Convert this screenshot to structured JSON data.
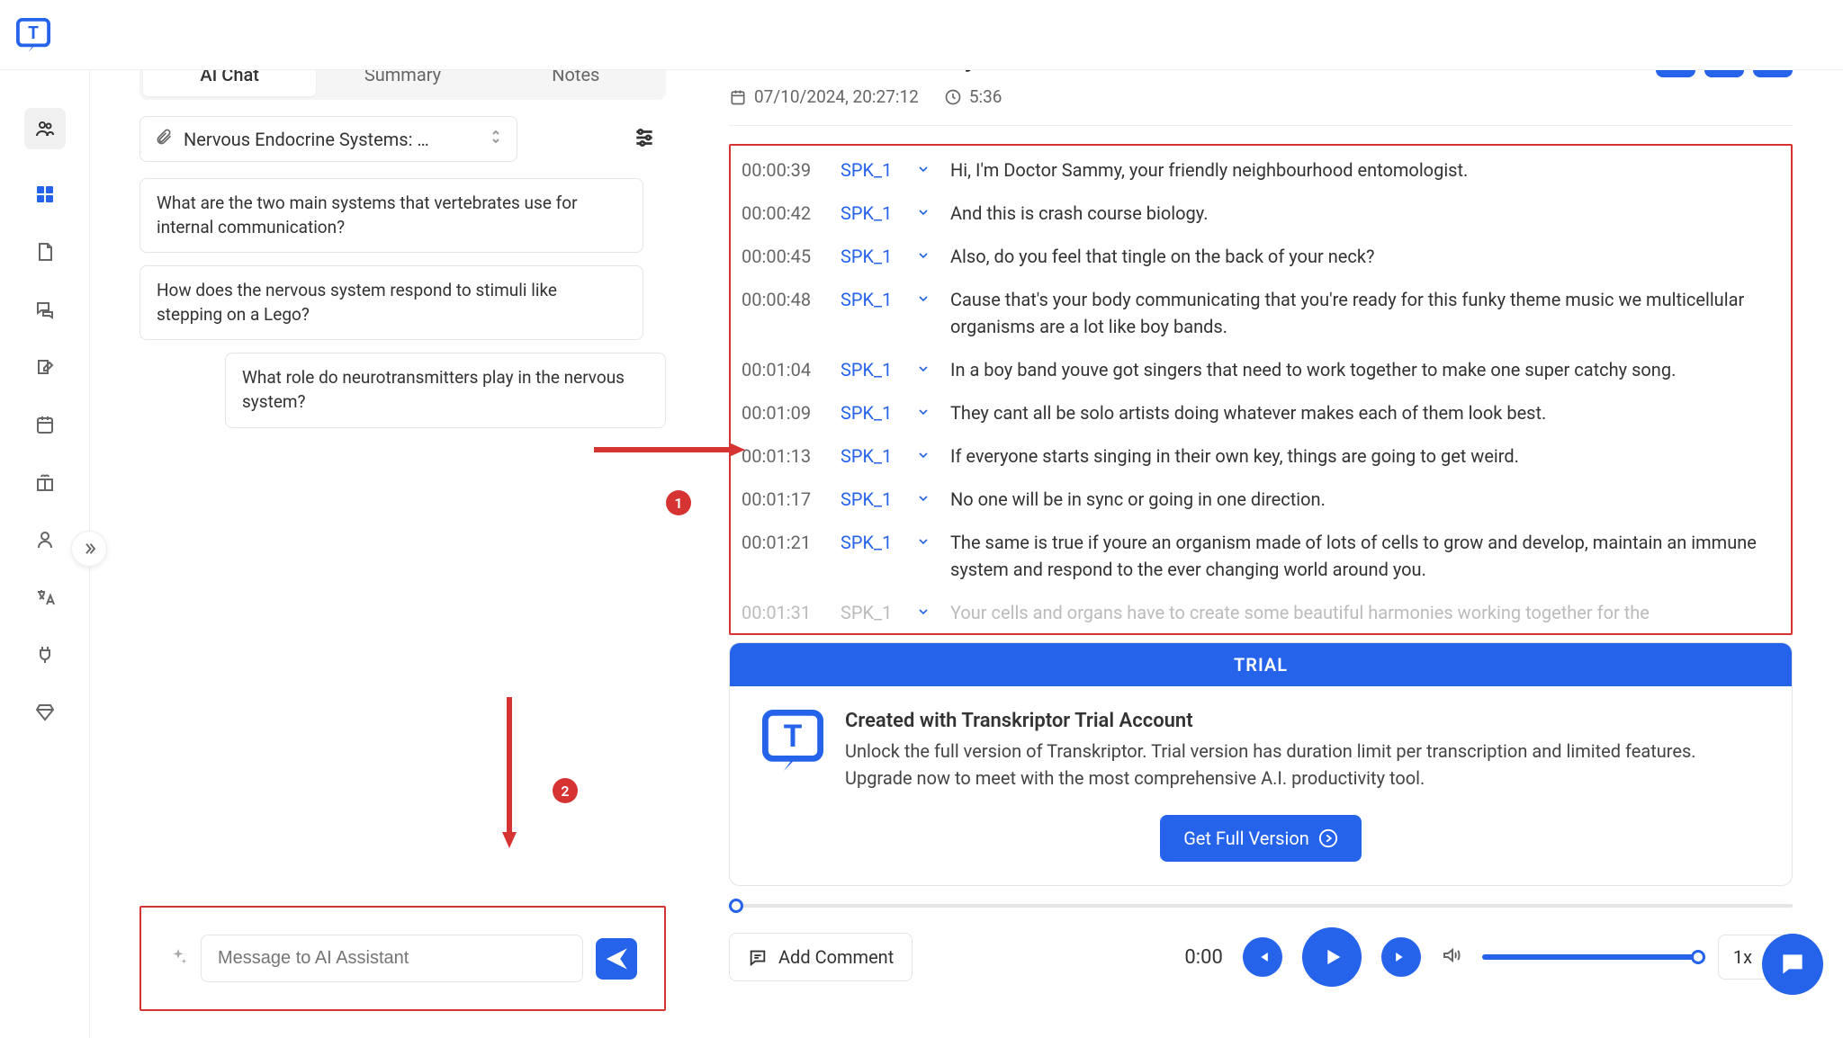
{
  "sidebar": {
    "icons": [
      "people",
      "grid",
      "document",
      "chat",
      "edit",
      "calendar",
      "gift",
      "person",
      "translate",
      "plug",
      "diamond"
    ]
  },
  "tabs": [
    {
      "label": "AI Chat",
      "active": true
    },
    {
      "label": "Summary",
      "active": false
    },
    {
      "label": "Notes",
      "active": false
    }
  ],
  "file_select": {
    "label": "Nervous Endocrine Systems: …"
  },
  "suggestions": [
    "What are the two main systems that vertebrates use for internal communication?",
    "How does the nervous system respond to stimuli like stepping on a Lego?",
    "What role do neurotransmitters play in the nervous system?"
  ],
  "annotations": {
    "badge1": "1",
    "badge2": "2"
  },
  "input": {
    "placeholder": "Message to AI Assistant"
  },
  "header": {
    "title": "Nervous Endocrine Sy...",
    "date": "07/10/2024, 20:27:12",
    "duration": "5:36"
  },
  "transcript": [
    {
      "ts": "00:00:39",
      "spk": "SPK_1",
      "txt": "Hi, I'm Doctor Sammy, your friendly neighbourhood entomologist."
    },
    {
      "ts": "00:00:42",
      "spk": "SPK_1",
      "txt": "And this is crash course biology."
    },
    {
      "ts": "00:00:45",
      "spk": "SPK_1",
      "txt": "Also, do you feel that tingle on the back of your neck?"
    },
    {
      "ts": "00:00:48",
      "spk": "SPK_1",
      "txt": "Cause that's your body communicating that you're ready for this funky theme music we multicellular organisms are a lot like boy bands."
    },
    {
      "ts": "00:01:04",
      "spk": "SPK_1",
      "txt": "In a boy band youve got singers that need to work together to make one super catchy song."
    },
    {
      "ts": "00:01:09",
      "spk": "SPK_1",
      "txt": "They cant all be solo artists doing whatever makes each of them look best."
    },
    {
      "ts": "00:01:13",
      "spk": "SPK_1",
      "txt": "If everyone starts singing in their own key, things are going to get weird."
    },
    {
      "ts": "00:01:17",
      "spk": "SPK_1",
      "txt": "No one will be in sync or going in one direction."
    },
    {
      "ts": "00:01:21",
      "spk": "SPK_1",
      "txt": "The same is true if youre an organism made of lots of cells to grow and develop, maintain an immune system and respond to the ever changing world around you."
    },
    {
      "ts": "00:01:31",
      "spk": "SPK_1",
      "txt": "Your cells and organs have to create some beautiful harmonies working together for the",
      "faded": true
    }
  ],
  "trial": {
    "banner": "TRIAL",
    "title": "Created with Transkriptor Trial Account",
    "body": "Unlock the full version of Transkriptor. Trial version has duration limit per transcription and limited features. Upgrade now to meet with the most comprehensive A.I. productivity tool.",
    "cta": "Get Full Version"
  },
  "player": {
    "add_comment": "Add Comment",
    "current": "0:00",
    "speed": "1x"
  }
}
